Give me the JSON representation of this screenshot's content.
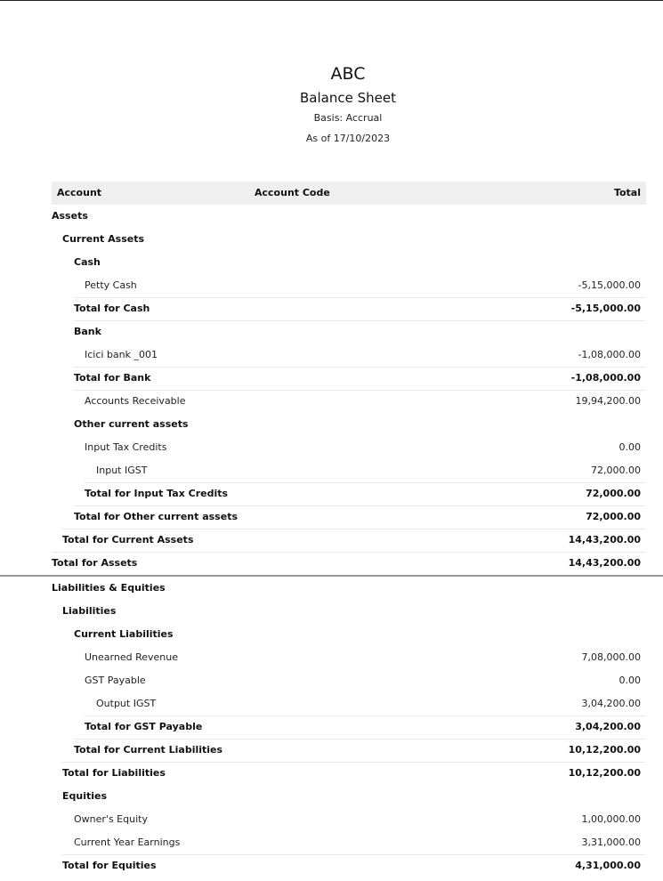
{
  "report": {
    "organization": "ABC",
    "title": "Balance Sheet",
    "basis": "Basis: Accrual",
    "as_of": "As of 17/10/2023"
  },
  "columns": {
    "account": "Account",
    "account_code": "Account Code",
    "total": "Total"
  },
  "rows": [
    {
      "label": "Assets",
      "amount": "",
      "level": 0,
      "bold": true
    },
    {
      "label": "Current Assets",
      "amount": "",
      "level": 1,
      "bold": true
    },
    {
      "label": "Cash",
      "amount": "",
      "level": 2,
      "bold": true
    },
    {
      "label": "Petty Cash",
      "amount": "-5,15,000.00",
      "level": 3,
      "bold": false
    },
    {
      "label": "Total for Cash",
      "amount": "-5,15,000.00",
      "level": 2,
      "bold": true
    },
    {
      "label": "Bank",
      "amount": "",
      "level": 2,
      "bold": true
    },
    {
      "label": "Icici bank _001",
      "amount": "-1,08,000.00",
      "level": 3,
      "bold": false
    },
    {
      "label": "Total for Bank",
      "amount": "-1,08,000.00",
      "level": 2,
      "bold": true
    },
    {
      "label": "Accounts Receivable",
      "amount": "19,94,200.00",
      "level": 3,
      "bold": false
    },
    {
      "label": "Other current assets",
      "amount": "",
      "level": 2,
      "bold": true
    },
    {
      "label": "Input Tax Credits",
      "amount": "0.00",
      "level": 3,
      "bold": false
    },
    {
      "label": "Input IGST",
      "amount": "72,000.00",
      "level": 4,
      "bold": false
    },
    {
      "label": "Total for Input Tax Credits",
      "amount": "72,000.00",
      "level": 3,
      "bold": true
    },
    {
      "label": "Total for Other current assets",
      "amount": "72,000.00",
      "level": 2,
      "bold": true
    },
    {
      "label": "Total for Current Assets",
      "amount": "14,43,200.00",
      "level": 1,
      "bold": true
    },
    {
      "label": "Total for Assets",
      "amount": "14,43,200.00",
      "level": 0,
      "bold": true
    },
    {
      "label": "Liabilities & Equities",
      "amount": "",
      "level": 0,
      "bold": true
    },
    {
      "label": "Liabilities",
      "amount": "",
      "level": 1,
      "bold": true
    },
    {
      "label": "Current Liabilities",
      "amount": "",
      "level": 2,
      "bold": true
    },
    {
      "label": "Unearned Revenue",
      "amount": "7,08,000.00",
      "level": 3,
      "bold": false
    },
    {
      "label": "GST Payable",
      "amount": "0.00",
      "level": 3,
      "bold": false
    },
    {
      "label": "Output IGST",
      "amount": "3,04,200.00",
      "level": 4,
      "bold": false
    },
    {
      "label": "Total for GST Payable",
      "amount": "3,04,200.00",
      "level": 3,
      "bold": true
    },
    {
      "label": "Total for Current Liabilities",
      "amount": "10,12,200.00",
      "level": 2,
      "bold": true
    },
    {
      "label": "Total for Liabilities",
      "amount": "10,12,200.00",
      "level": 1,
      "bold": true
    },
    {
      "label": "Equities",
      "amount": "",
      "level": 1,
      "bold": true
    },
    {
      "label": "Owner's Equity",
      "amount": "1,00,000.00",
      "level": 2,
      "bold": false
    },
    {
      "label": "Current Year Earnings",
      "amount": "3,31,000.00",
      "level": 2,
      "bold": false
    },
    {
      "label": "Total for Equities",
      "amount": "4,31,000.00",
      "level": 1,
      "bold": true
    }
  ]
}
